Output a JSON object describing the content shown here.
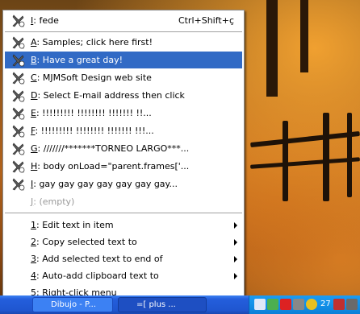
{
  "menu": {
    "items": [
      {
        "accel": "I",
        "text": "fede",
        "shortcut": "Ctrl+Shift+ç"
      },
      {
        "accel": "A",
        "text": "Samples; click here first!"
      },
      {
        "accel": "B",
        "text": "Have a great day!",
        "selected": true
      },
      {
        "accel": "C",
        "text": "MJMSoft Design web site"
      },
      {
        "accel": "D",
        "text": "Select E-mail address then click"
      },
      {
        "accel": "E",
        "text": "!!!!!!!!! !!!!!!!! !!!!!!! !!..."
      },
      {
        "accel": "F",
        "text": "!!!!!!!!! !!!!!!!! !!!!!!! !!!..."
      },
      {
        "accel": "G",
        "text": "///////*******TORNEO LARGO***..."
      },
      {
        "accel": "H",
        "text": "body onLoad=\"parent.frames['..."
      },
      {
        "accel": "I",
        "text": "gay gay gay gay gay gay gay..."
      },
      {
        "accel": "J",
        "text": "(empty)",
        "disabled": true
      }
    ],
    "actions": [
      {
        "accel": "1",
        "text": "Edit text in item"
      },
      {
        "accel": "2",
        "text": "Copy selected text to"
      },
      {
        "accel": "3",
        "text": "Add selected text to end of"
      },
      {
        "accel": "4",
        "text": "Auto-add clipboard text to"
      },
      {
        "accel": "5",
        "text": "Right-click menu"
      }
    ]
  },
  "taskbar": {
    "buttons": [
      {
        "label": "Dibujo - P..."
      },
      {
        "label": "=[ plus ..."
      }
    ],
    "clock": "27"
  },
  "colors": {
    "selection": "#316ac5",
    "taskbar": "#245edc",
    "tray": "#1290e8"
  }
}
